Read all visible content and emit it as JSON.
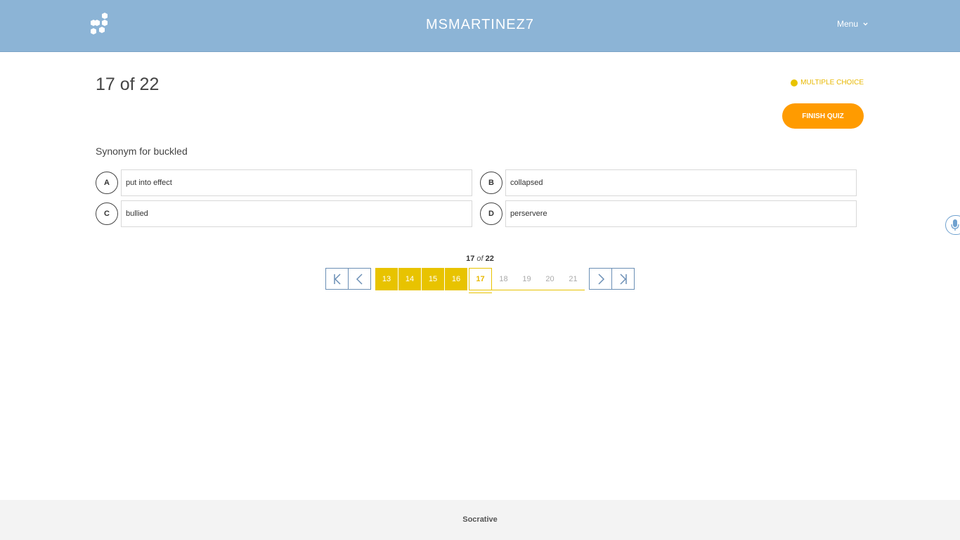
{
  "header": {
    "room_name": "MSMARTINEZ7",
    "menu_label": "Menu",
    "background_color": "#8cb4d6"
  },
  "quiz": {
    "progress_title": "17 of 22",
    "question_type": "MULTIPLE CHOICE",
    "finish_label": "FINISH QUIZ",
    "question": "Synonym for buckled",
    "answers": [
      {
        "letter": "A",
        "text": "put into effect"
      },
      {
        "letter": "B",
        "text": "collapsed"
      },
      {
        "letter": "C",
        "text": "bullied"
      },
      {
        "letter": "D",
        "text": "perservere"
      }
    ]
  },
  "pager": {
    "current": "17",
    "of": "of",
    "total": "22",
    "pages": [
      {
        "label": "13",
        "state": "done"
      },
      {
        "label": "14",
        "state": "done"
      },
      {
        "label": "15",
        "state": "done"
      },
      {
        "label": "16",
        "state": "done"
      },
      {
        "label": "17",
        "state": "current"
      },
      {
        "label": "18",
        "state": "todo"
      },
      {
        "label": "19",
        "state": "todo"
      },
      {
        "label": "20",
        "state": "todo"
      },
      {
        "label": "21",
        "state": "todo"
      }
    ],
    "icons": [
      "first-page-icon",
      "previous-page-icon",
      "next-page-icon",
      "last-page-icon"
    ]
  },
  "footer": {
    "brand": "Socrative"
  },
  "colors": {
    "accent_yellow": "#e8c300",
    "finish_orange": "#ff9b00",
    "nav_blue": "#6b8fb5"
  }
}
